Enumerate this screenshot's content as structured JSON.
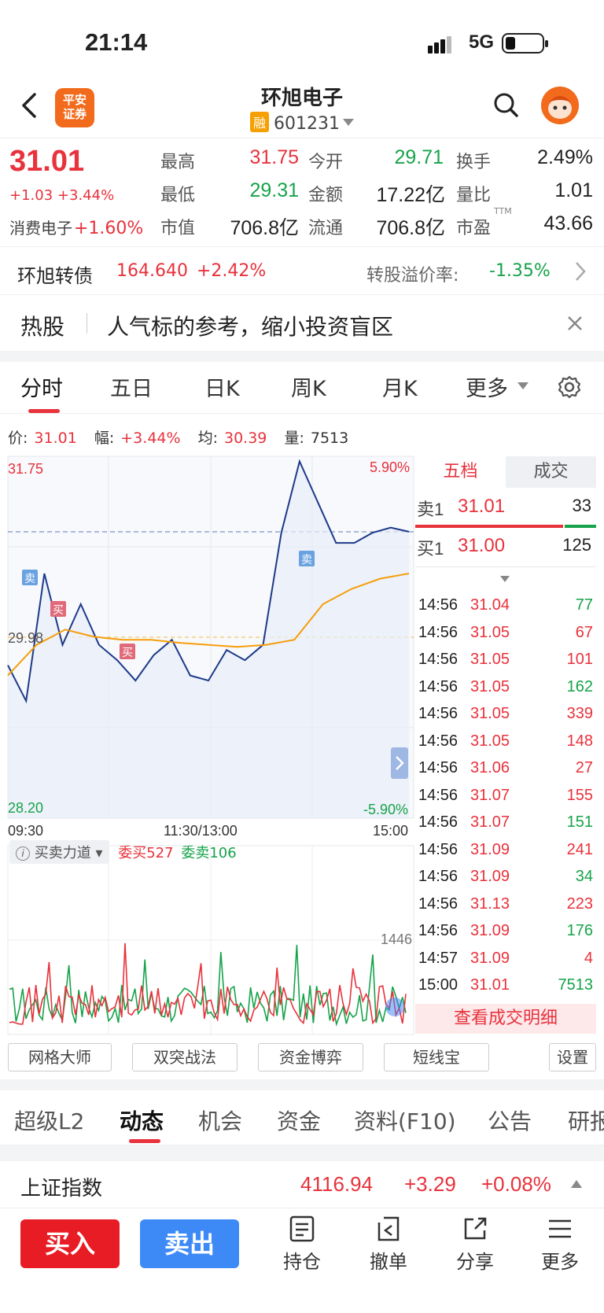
{
  "status": {
    "time": "21:14",
    "network": "5G"
  },
  "header": {
    "broker_logo_line1": "平安",
    "broker_logo_line2": "证券",
    "name": "环旭电子",
    "margin_badge": "融",
    "code": "601231"
  },
  "quote": {
    "price": "31.01",
    "change": "+1.03",
    "change_pct": "+3.44%",
    "sector_name": "消费电子",
    "sector_pct": "+1.60%",
    "high_label": "最高",
    "high": "31.75",
    "open_label": "今开",
    "open": "29.71",
    "turnover_label": "换手",
    "turnover": "2.49%",
    "low_label": "最低",
    "low": "29.31",
    "amount_label": "金额",
    "amount": "17.22亿",
    "vol_ratio_label": "量比",
    "vol_ratio": "1.01",
    "mcap_label": "市值",
    "mcap": "706.8亿",
    "float_label": "流通",
    "float_cap": "706.8亿",
    "pe_label": "市盈",
    "pe_sup": "TTM",
    "pe": "43.66"
  },
  "bond": {
    "name": "环旭转债",
    "price": "164.640",
    "pct": "+2.42%",
    "premium_label": "转股溢价率:",
    "premium": "-1.35%"
  },
  "hot": {
    "tag": "热股",
    "text": "人气标的参考，缩小投资盲区"
  },
  "chart_tabs": [
    "分时",
    "五日",
    "日K",
    "周K",
    "月K",
    "更多"
  ],
  "info": {
    "price_label": "价:",
    "price": "31.01",
    "amp_label": "幅:",
    "amp": "+3.44%",
    "avg_label": "均:",
    "avg": "30.39",
    "vol_label": "量:",
    "vol": "7513"
  },
  "chart": {
    "y_top": "31.75",
    "y_mid": "29.98",
    "y_bot": "28.20",
    "pct_top": "5.90%",
    "pct_bot": "-5.90%",
    "x_start": "09:30",
    "x_mid": "11:30/13:00",
    "x_end": "15:00",
    "buy_mark": "买",
    "sell_mark": "卖"
  },
  "chart_data": {
    "type": "line",
    "x": [
      "09:30",
      "11:30/13:00",
      "15:00"
    ],
    "ylim": [
      28.2,
      31.75
    ],
    "prev_close": 29.98,
    "series": [
      {
        "values": [
          29.7,
          29.35,
          30.6,
          29.9,
          30.3,
          29.9,
          29.75,
          29.55,
          29.8,
          29.95,
          29.6,
          29.55,
          29.85,
          29.75,
          29.9,
          31.0,
          31.7,
          31.3,
          30.9,
          30.9,
          31.0,
          31.05,
          31.01
        ]
      },
      {
        "values": [
          29.6,
          29.9,
          30.05,
          29.98,
          29.95,
          29.95,
          29.92,
          29.9,
          29.88,
          29.9,
          29.95,
          30.3,
          30.45,
          30.55,
          30.6
        ]
      }
    ]
  },
  "flow": {
    "label": "买卖力道",
    "buy": "委买527",
    "sell": "委卖106",
    "peak": "1446"
  },
  "orderbook": {
    "tab_level": "五档",
    "tab_trades": "成交",
    "sell1_label": "卖1",
    "sell1_price": "31.01",
    "sell1_vol": "33",
    "buy1_label": "买1",
    "buy1_price": "31.00",
    "buy1_vol": "125",
    "ticks": [
      {
        "t": "14:56",
        "p": "31.04",
        "v": "77",
        "side": "buy"
      },
      {
        "t": "14:56",
        "p": "31.05",
        "v": "67",
        "side": "sell"
      },
      {
        "t": "14:56",
        "p": "31.05",
        "v": "101",
        "side": "sell"
      },
      {
        "t": "14:56",
        "p": "31.05",
        "v": "162",
        "side": "buy"
      },
      {
        "t": "14:56",
        "p": "31.05",
        "v": "339",
        "side": "sell"
      },
      {
        "t": "14:56",
        "p": "31.05",
        "v": "148",
        "side": "sell"
      },
      {
        "t": "14:56",
        "p": "31.06",
        "v": "27",
        "side": "sell"
      },
      {
        "t": "14:56",
        "p": "31.07",
        "v": "155",
        "side": "sell"
      },
      {
        "t": "14:56",
        "p": "31.07",
        "v": "151",
        "side": "buy"
      },
      {
        "t": "14:56",
        "p": "31.09",
        "v": "241",
        "side": "sell"
      },
      {
        "t": "14:56",
        "p": "31.09",
        "v": "34",
        "side": "buy"
      },
      {
        "t": "14:56",
        "p": "31.13",
        "v": "223",
        "side": "sell"
      },
      {
        "t": "14:56",
        "p": "31.09",
        "v": "176",
        "side": "buy"
      },
      {
        "t": "14:57",
        "p": "31.09",
        "v": "4",
        "side": "sell"
      },
      {
        "t": "15:00",
        "p": "31.01",
        "v": "7513",
        "side": "buy"
      }
    ],
    "detail_button": "查看成交明细"
  },
  "tools": [
    "网格大师",
    "双突战法",
    "资金博弈",
    "短线宝",
    "设置"
  ],
  "bottom_tabs": [
    "超级L2",
    "动态",
    "机会",
    "资金",
    "资料(F10)",
    "公告",
    "研报"
  ],
  "index": {
    "name": "上证指数",
    "value": "4116.94",
    "change": "+3.29",
    "pct": "+0.08%"
  },
  "actions": {
    "buy": "买入",
    "sell": "卖出",
    "holdings": "持仓",
    "cancel": "撤单",
    "share": "分享",
    "more": "更多"
  },
  "colors": {
    "up": "#e8323c",
    "down": "#16a34a",
    "accent": "#3d8af7",
    "line": "#1e3a8a",
    "avg": "#f59e0b"
  }
}
